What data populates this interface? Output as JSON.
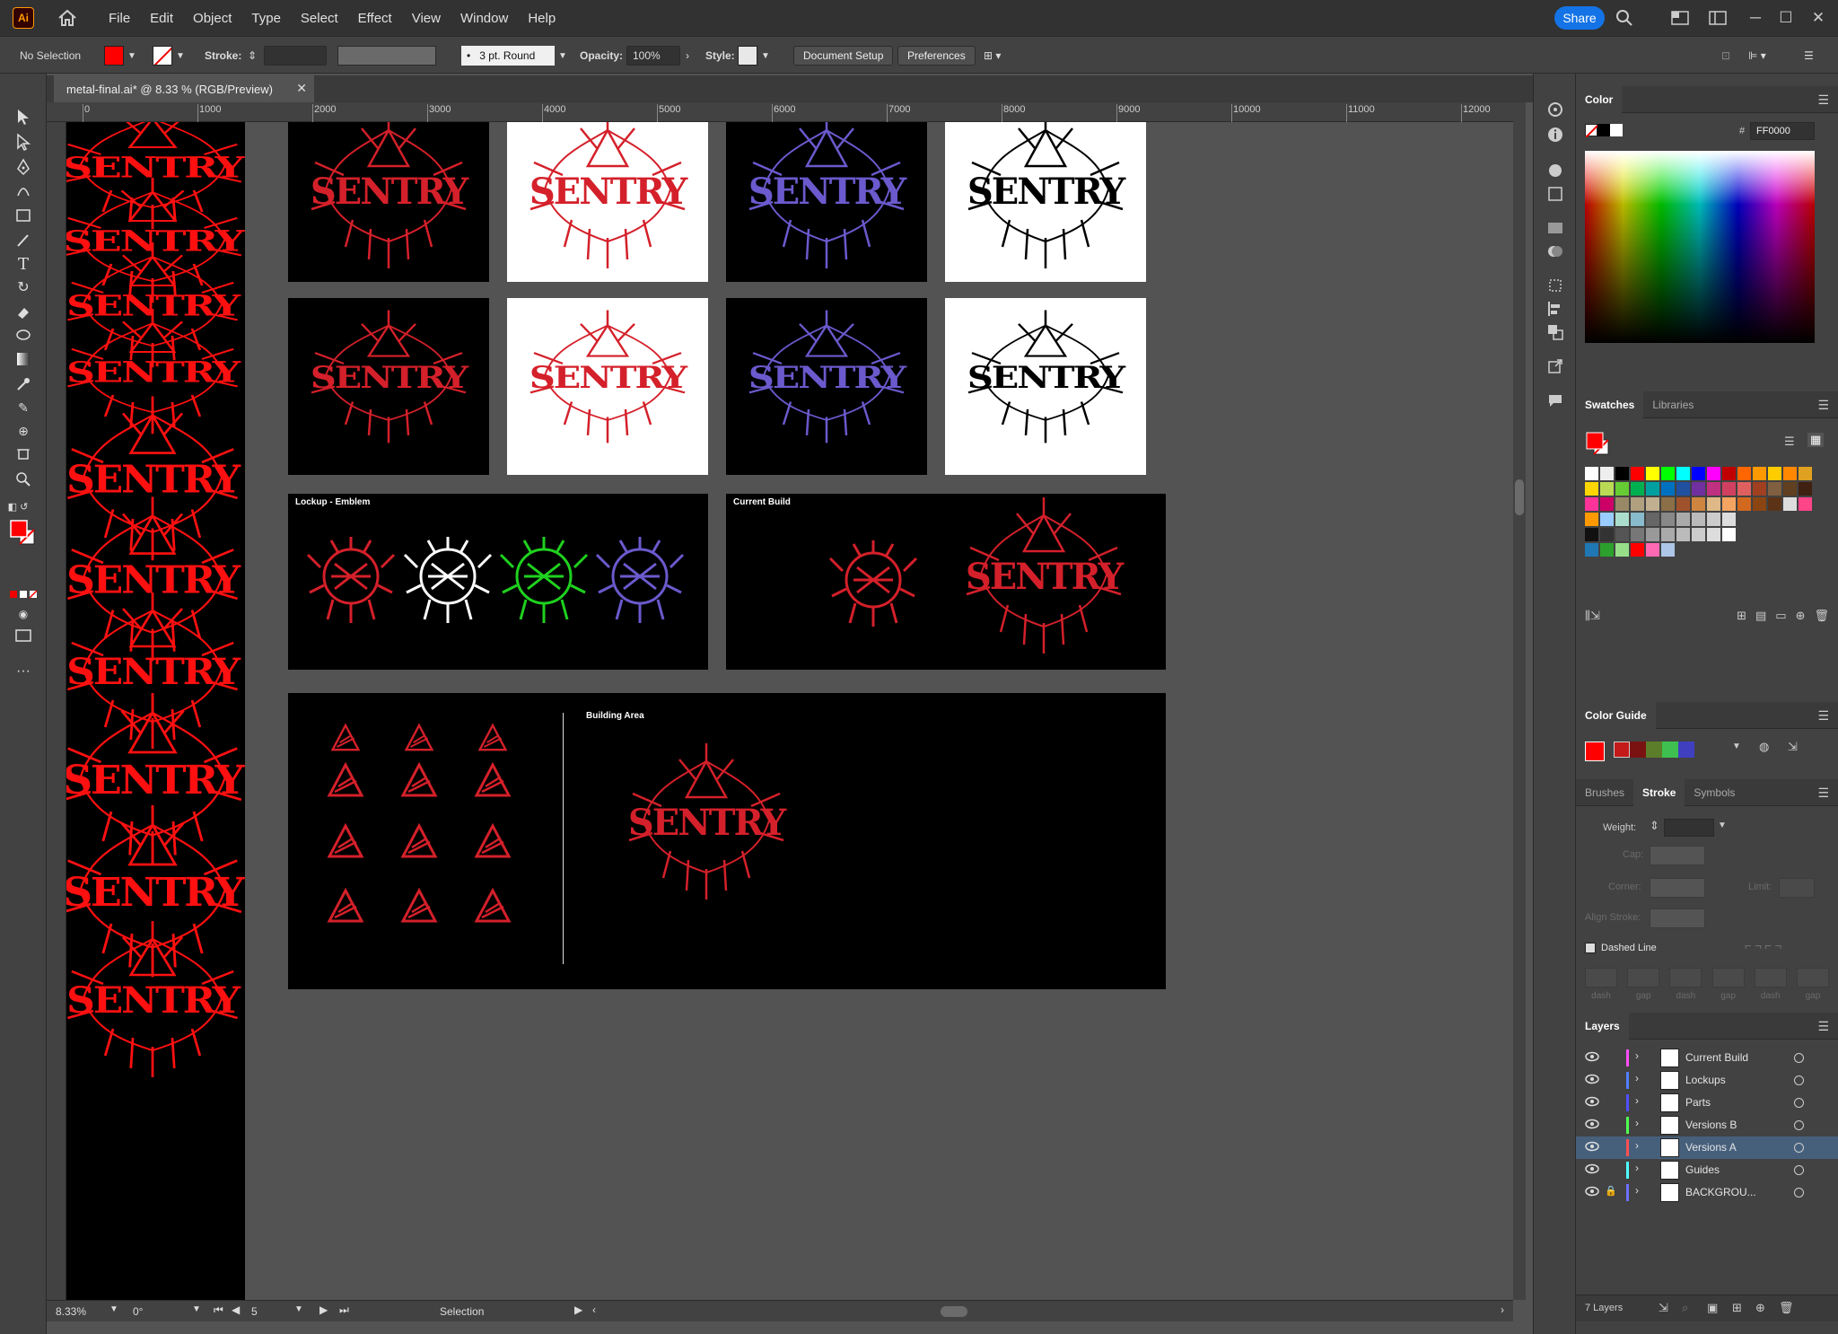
{
  "app": {
    "logo": "Ai",
    "menus": [
      "File",
      "Edit",
      "Object",
      "Type",
      "Select",
      "Effect",
      "View",
      "Window",
      "Help"
    ],
    "share_label": "Share"
  },
  "control": {
    "selection": "No Selection",
    "fill_color": "#ff0000",
    "stroke_label": "Stroke:",
    "brush_profile": "3 pt. Round",
    "opacity_label": "Opacity:",
    "opacity_value": "100%",
    "style_label": "Style:",
    "document_setup": "Document Setup",
    "preferences": "Preferences"
  },
  "document": {
    "tab_title": "metal-final.ai* @ 8.33 % (RGB/Preview)"
  },
  "ruler": {
    "h_ticks": [
      "0",
      "1000",
      "2000",
      "3000",
      "4000",
      "5000",
      "6000",
      "7000",
      "8000",
      "9000",
      "10000",
      "11000",
      "12000"
    ]
  },
  "artwork": {
    "logo_text": "SENTRY",
    "label_lockup": "Lockup - Emblem",
    "label_current": "Current Build",
    "label_building": "Building Area",
    "colors": {
      "red": "#d4202a",
      "blood": "#ff1010",
      "purple": "#6a5acd",
      "green": "#1fd11f",
      "white": "#ffffff",
      "black": "#000000"
    }
  },
  "status": {
    "zoom": "8.33%",
    "rotate": "0°",
    "artboard": "5",
    "tool": "Selection"
  },
  "panels": {
    "color": {
      "title": "Color",
      "hex_label": "#",
      "hex": "FF0000"
    },
    "swatches": {
      "tab": "Swatches",
      "tab2": "Libraries"
    },
    "color_guide": {
      "title": "Color Guide"
    },
    "stroke": {
      "tab1": "Brushes",
      "tab2": "Stroke",
      "tab3": "Symbols",
      "weight": "Weight:",
      "cap": "Cap:",
      "corner": "Corner:",
      "limit": "Limit:",
      "align": "Align Stroke:",
      "dashed": "Dashed Line",
      "dash_labels": [
        "dash",
        "gap",
        "dash",
        "gap",
        "dash",
        "gap"
      ]
    },
    "layers": {
      "title": "Layers",
      "count": "7 Layers",
      "items": [
        {
          "name": "Current Build",
          "color": "#ff4fff"
        },
        {
          "name": "Lockups",
          "color": "#4f7fff"
        },
        {
          "name": "Parts",
          "color": "#4f4fff"
        },
        {
          "name": "Versions B",
          "color": "#4fff4f"
        },
        {
          "name": "Versions A",
          "color": "#ff4f4f"
        },
        {
          "name": "Guides",
          "color": "#4fffff"
        },
        {
          "name": "BACKGROU...",
          "color": "#6f6fff"
        }
      ]
    }
  }
}
